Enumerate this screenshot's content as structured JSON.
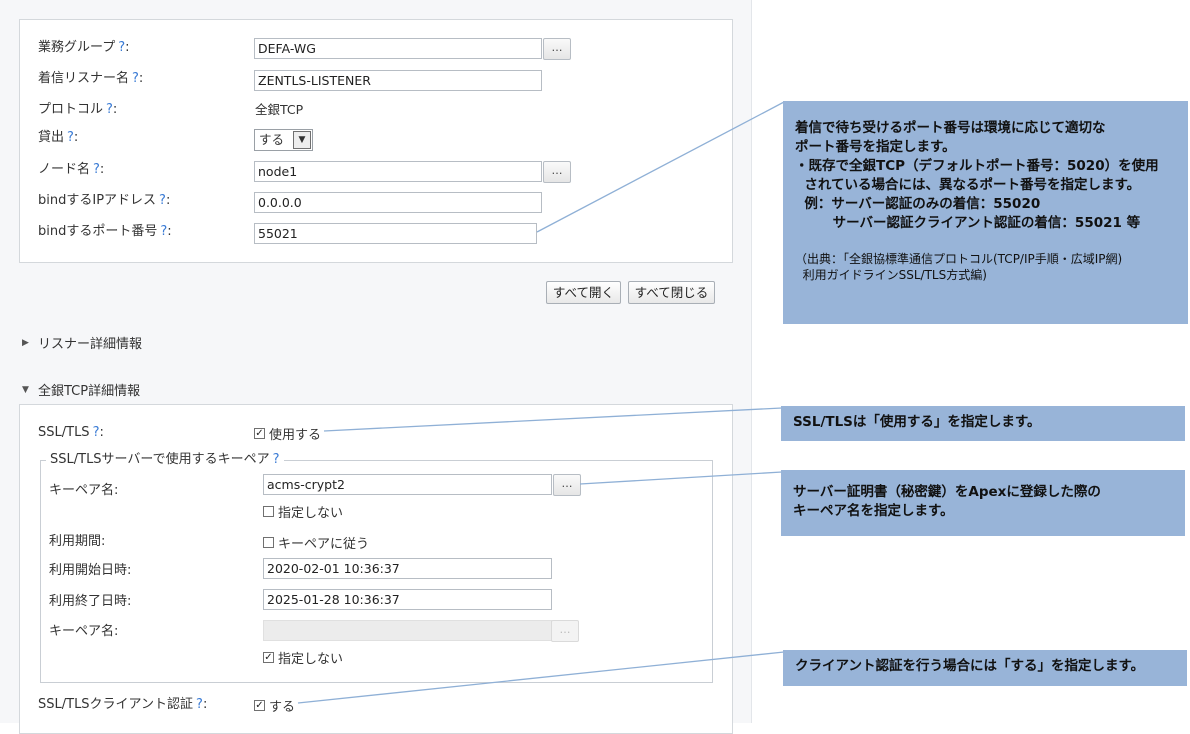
{
  "form": {
    "help_glyph": "?",
    "gyomu_group": {
      "label": "業務グループ",
      "value": "DEFA-WG",
      "browse": "…"
    },
    "listener_name": {
      "label": "着信リスナー名",
      "value": "ZENTLS-LISTENER"
    },
    "protocol": {
      "label": "プロトコル",
      "value": "全銀TCP"
    },
    "kashidashi": {
      "label": "貸出",
      "value": "する"
    },
    "node": {
      "label": "ノード名",
      "value": "node1",
      "browse": "…"
    },
    "bind_ip": {
      "label": "bindするIPアドレス",
      "value": "0.0.0.0"
    },
    "bind_port": {
      "label": "bindするポート番号",
      "value": "55021"
    }
  },
  "actions": {
    "open_all": "すべて開く",
    "close_all": "すべて閉じる"
  },
  "sections": {
    "listener_detail": "リスナー詳細情報",
    "zengin_detail": "全銀TCP詳細情報"
  },
  "tls": {
    "ssl_tls": {
      "label": "SSL/TLS",
      "check": "使用する",
      "checked": true
    },
    "keypair_group": {
      "legend": "SSL/TLSサーバーで使用するキーペア",
      "keypair_name": {
        "label": "キーペア名:",
        "value": "acms-crypt2",
        "browse": "…"
      },
      "not_specified_1": {
        "label": "指定しない",
        "checked": false
      },
      "period": {
        "label": "利用期間:",
        "check": "キーペアに従う",
        "checked": false
      },
      "start": {
        "label": "利用開始日時:",
        "value": "2020-02-01 10:36:37"
      },
      "end": {
        "label": "利用終了日時:",
        "value": "2025-01-28 10:36:37"
      },
      "keypair_name2": {
        "label": "キーペア名:",
        "value": "",
        "browse": "…"
      },
      "not_specified_2": {
        "label": "指定しない",
        "checked": true
      }
    },
    "client_auth": {
      "label": "SSL/TLSクライアント認証",
      "check": "する",
      "checked": true
    }
  },
  "notes": {
    "port": {
      "lines": [
        "着信で待ち受けるポート番号は環境に応じて適切な",
        "ポート番号を指定します。",
        "・既存で全銀TCP（デフォルトポート番号：5020）を使用",
        "  されている場合には、異なるポート番号を指定します。",
        "  例：サーバー認証のみの着信：55020",
        "        サーバー認証クライアント認証の着信：55021 等"
      ],
      "source": [
        "（出典：「全銀協標準通信プロトコル(TCP/IP手順・広域IP網)",
        "  利用ガイドラインSSL/TLS方式編)"
      ]
    },
    "ssl": "SSL/TLSは「使用する」を指定します。",
    "keypair": [
      "サーバー証明書（秘密鍵）をApexに登録した際の",
      "キーペア名を指定します。"
    ],
    "client": "クライアント認証を行う場合には「する」を指定します。"
  },
  "colors": {
    "note_bg": "#98b4d8",
    "leader_line": "#8fb0d6",
    "help": "#3a7bd5"
  }
}
